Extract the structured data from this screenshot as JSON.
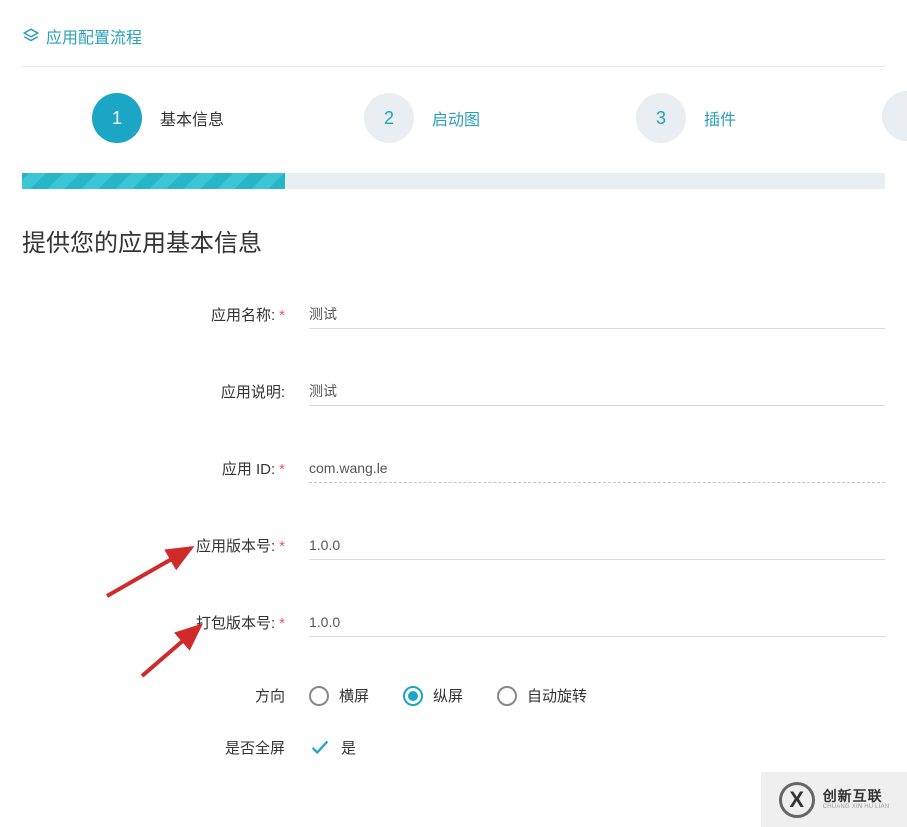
{
  "header": {
    "title": "应用配置流程"
  },
  "steps": [
    {
      "num": "1",
      "label": "基本信息"
    },
    {
      "num": "2",
      "label": "启动图"
    },
    {
      "num": "3",
      "label": "插件"
    }
  ],
  "section_title": "提供您的应用基本信息",
  "labels": {
    "app_name": "应用名称:",
    "app_desc": "应用说明:",
    "app_id": "应用 ID:",
    "app_version": "应用版本号:",
    "pkg_version": "打包版本号:",
    "orientation": "方向",
    "fullscreen": "是否全屏"
  },
  "values": {
    "app_name": "测试",
    "app_desc": "测试",
    "app_id": "com.wang.le",
    "app_version": "1.0.0",
    "pkg_version": "1.0.0"
  },
  "orientation_options": {
    "landscape": "横屏",
    "portrait": "纵屏",
    "auto": "自动旋转"
  },
  "fullscreen_value": "是",
  "footer": {
    "cn": "创新互联",
    "en": "CHUANG XIN HU LIAN"
  }
}
